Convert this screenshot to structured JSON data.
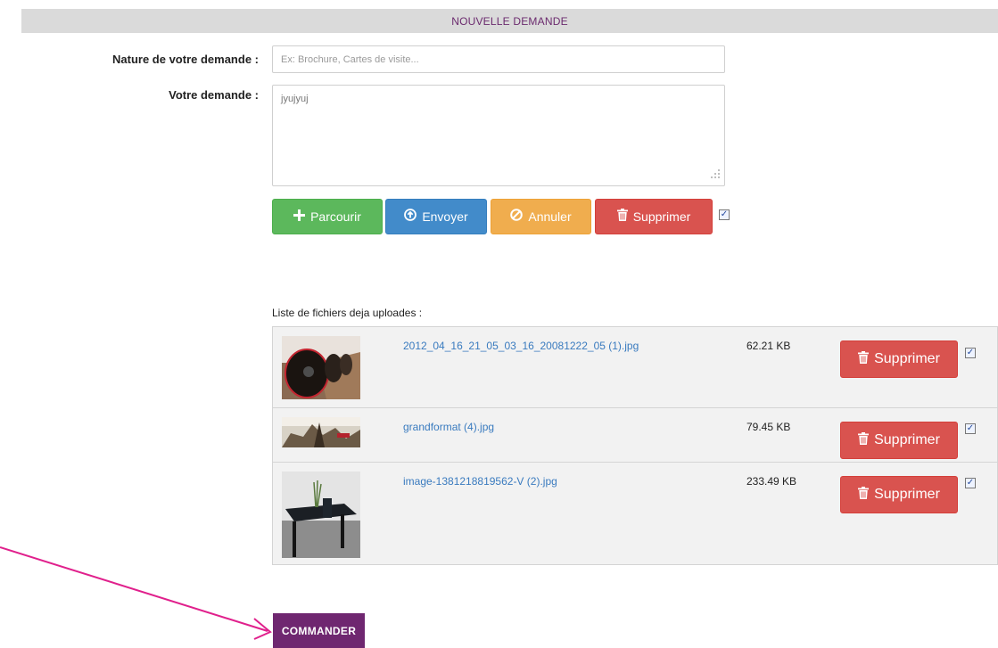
{
  "header": {
    "title": "NOUVELLE DEMANDE"
  },
  "form": {
    "nature_label": "Nature de votre demande :",
    "nature_placeholder": "Ex: Brochure, Cartes de visite...",
    "nature_value": "",
    "demande_label": "Votre demande :",
    "demande_value": "jyujyuj"
  },
  "upload_toolbar": {
    "browse_label": "Parcourir",
    "send_label": "Envoyer",
    "cancel_label": "Annuler",
    "delete_label": "Supprimer",
    "select_all_checked": true
  },
  "files": {
    "title": "Liste de fichiers deja uploades :",
    "delete_label": "Supprimer",
    "items": [
      {
        "name": "2012_04_16_21_05_03_16_20081222_05 (1).jpg",
        "size": "62.21 KB",
        "checked": true
      },
      {
        "name": "grandformat (4).jpg",
        "size": "79.45 KB",
        "checked": true
      },
      {
        "name": "image-1381218819562-V (2).jpg",
        "size": "233.49 KB",
        "checked": true
      }
    ]
  },
  "order_button": {
    "label": "COMMANDER"
  },
  "icons": {
    "browse": "plus-icon",
    "send": "upload-circle-icon",
    "cancel": "ban-icon",
    "delete": "trash-icon"
  },
  "colors": {
    "accent": "#6f2770",
    "green": "#5cb85c",
    "blue": "#428bca",
    "orange": "#f0ad4e",
    "red": "#d9534f",
    "arrow": "#e0208c"
  }
}
